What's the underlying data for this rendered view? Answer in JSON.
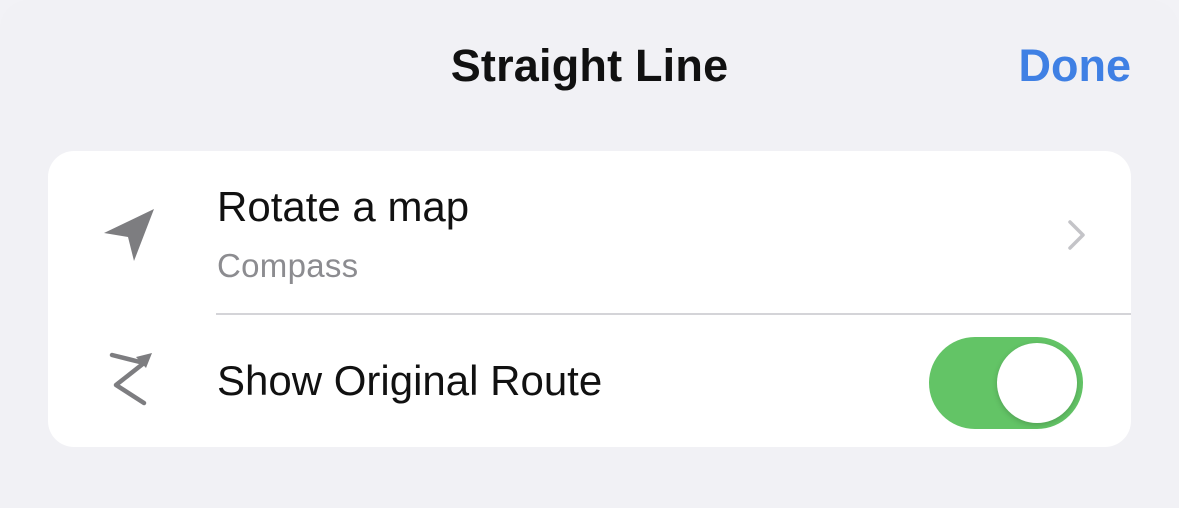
{
  "header": {
    "title": "Straight Line",
    "done_label": "Done"
  },
  "settings": {
    "rotate_row": {
      "label": "Rotate a map",
      "value": "Compass",
      "icon": "location-arrow-icon"
    },
    "route_row": {
      "label": "Show Original Route",
      "icon": "route-zigzag-icon",
      "toggle_on": true
    }
  },
  "colors": {
    "accent": "#3f80e4",
    "toggle_on": "#63c466",
    "icon_gray": "#7d7d80"
  }
}
